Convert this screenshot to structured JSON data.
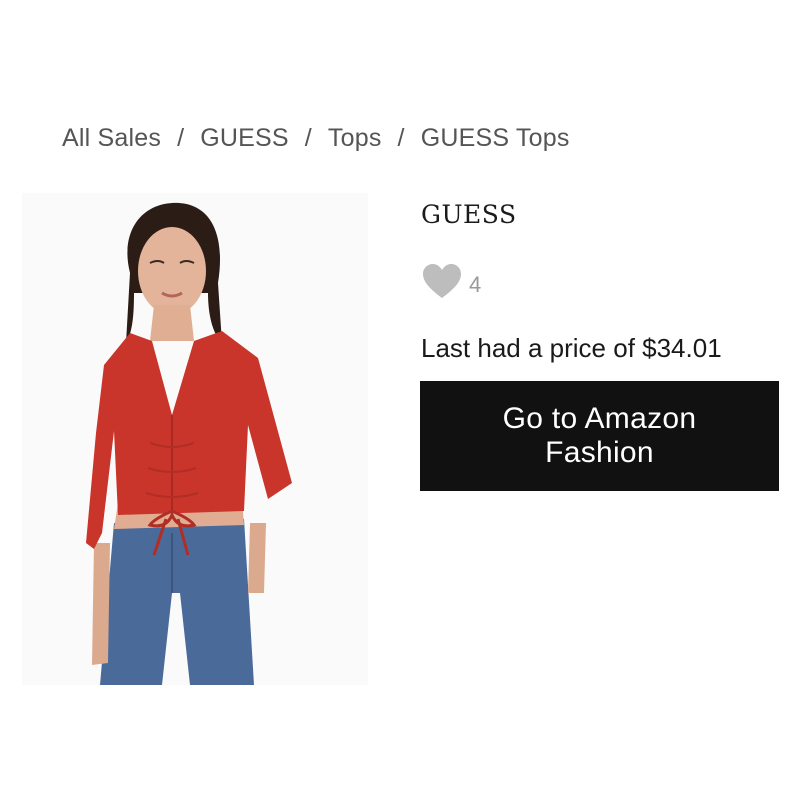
{
  "breadcrumb": {
    "items": [
      "All Sales",
      "GUESS",
      "Tops",
      "GUESS Tops"
    ],
    "separator": "/"
  },
  "product": {
    "brand": "GUESS",
    "likes_count": "4",
    "price_text": "Last had a price of $34.01",
    "cta_label": "Go to Amazon Fashion",
    "image": {
      "icon": "product-photo-red-ruched-crop-top",
      "top_color": "#c9352b",
      "jeans_color": "#4a6a9a"
    }
  },
  "colors": {
    "cta_background": "#111111",
    "heart": "#bdbdbd"
  }
}
